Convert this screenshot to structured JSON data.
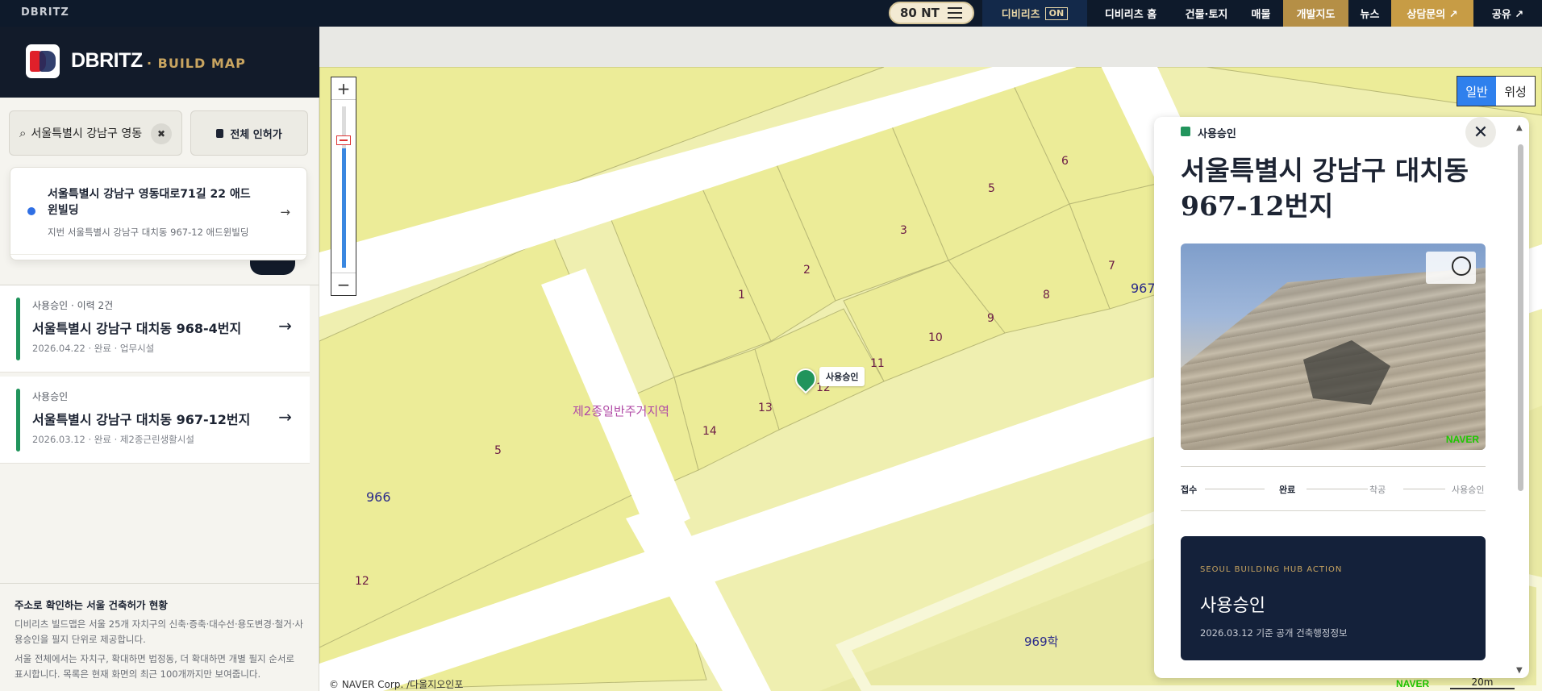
{
  "topbar": {
    "brand": "DBRITZ",
    "nt_label": "80 NT",
    "nav": [
      {
        "label": "디비리츠",
        "badge": "ON"
      },
      {
        "label": "디비리츠 홈"
      },
      {
        "label": "건물·토지"
      },
      {
        "label": "매물"
      },
      {
        "label": "개발지도"
      },
      {
        "label": "뉴스"
      },
      {
        "label": "상담문의 ↗"
      },
      {
        "label": "공유 ↗"
      }
    ]
  },
  "sidebar": {
    "logo_text": "DBRITZ",
    "logo_sub": "· BUILD MAP",
    "search": {
      "value": "서울특별시 강남구 영동",
      "clear_icon": "✖"
    },
    "all_button": "전체 인허가",
    "suggestion": {
      "line1": "서울특별시 강남구 영동대로71길 22 애드윈빌딩",
      "line2": "지번 서울특별시 강남구 대치동 967-12 애드윈빌딩",
      "arrow": "→"
    },
    "items": [
      {
        "meta": "사용승인 · 이력 2건",
        "title": "서울특별시 강남구 대치동 968-4번지",
        "sub": "2026.04.22 · 완료 · 업무시설",
        "arrow": "→"
      },
      {
        "meta": "사용승인",
        "title": "서울특별시 강남구 대치동 967-12번지",
        "sub": "2026.03.12 · 완료 · 제2종근린생활시설",
        "arrow": "→"
      }
    ],
    "footer": {
      "title": "주소로 확인하는 서울 건축허가 현황",
      "p1": "디비리츠 빌드맵은 서울 25개 자치구의 신축·증축·대수선·용도변경·철거·사용승인을 필지 단위로 제공합니다.",
      "p2": "서울 전체에서는 자치구, 확대하면 법정동, 더 확대하면 개별 필지 순서로 표시합니다. 목록은 현재 화면의 최근 100개까지만 보여줍니다."
    }
  },
  "map": {
    "zoom_in": "+",
    "zoom_out": "−",
    "zoom_level_fraction": 0.74,
    "map_types": [
      "일반",
      "위성"
    ],
    "active_map_type": "일반",
    "labels": {
      "block_967": "967",
      "block_966": "966",
      "block_969": "969학",
      "zone": "제2종일반주거지역",
      "p1": "1",
      "p2": "2",
      "p3": "3",
      "p5a": "5",
      "p6": "6",
      "p7": "7",
      "p8": "8",
      "p9": "9",
      "p10": "10",
      "p11": "11",
      "p12": "12",
      "p13": "13",
      "p14": "14",
      "p5b": "5",
      "p12b": "12"
    },
    "marker_label": "사용승인",
    "copyright": "© NAVER Corp. /다울지오인포",
    "naver": "NAVER",
    "scale": "20m"
  },
  "panel": {
    "badge": "사용승인",
    "close_icon": "close-icon",
    "address": "서울특별시 강남구 대치동 967-12번지",
    "photo_watermark": "NAVER",
    "steps": [
      "접수",
      "완료",
      "착공",
      "사용승인"
    ],
    "action": {
      "kicker": "SEOUL BUILDING HUB ACTION",
      "title": "사용승인",
      "sub": "2026.03.12 기준 공개 건축행정정보"
    }
  },
  "colors": {
    "topbar": "#0e1a2b",
    "accent_gold": "#c9a560",
    "status_green": "#21945c",
    "map_parcel": "#eeee9a",
    "action_card": "#14213a"
  }
}
